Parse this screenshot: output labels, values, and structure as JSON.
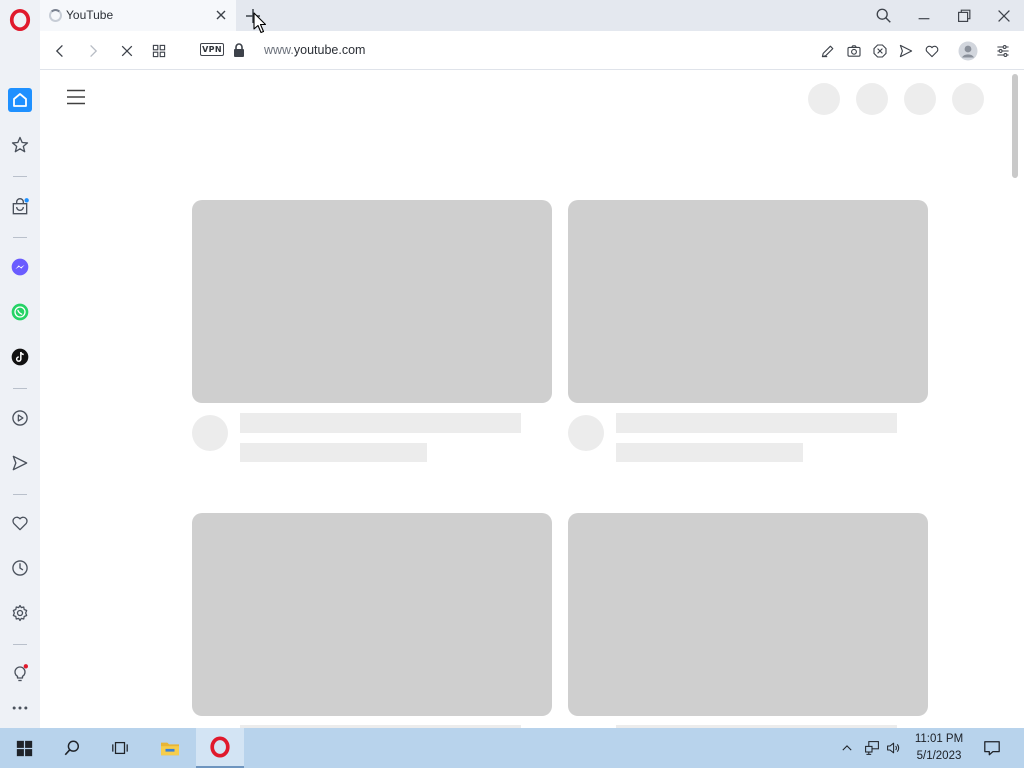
{
  "colors": {
    "sidebar_bg": "#eef1f6",
    "accent_blue": "#1e90ff",
    "messenger": "#6a5cff",
    "whatsapp": "#25d366",
    "tiktok": "#111111",
    "opera_red": "#e0192c",
    "skeleton_dark": "#cfcfcf",
    "skeleton_light": "#ececec",
    "taskbar_bg": "#b8d3ec"
  },
  "browser": {
    "tab": {
      "title": "YouTube",
      "loading": true
    },
    "address": {
      "vpn_label": "VPN",
      "url_dim": "www.",
      "url_main": "youtube.com"
    },
    "sidebar_icons": [
      "opera-logo-icon",
      "home-icon",
      "star-icon",
      "shopping-bag-icon",
      "messenger-icon",
      "whatsapp-icon",
      "tiktok-icon",
      "player-icon",
      "send-icon",
      "heart-icon",
      "history-icon",
      "settings-icon",
      "lightbulb-icon",
      "more-icon"
    ],
    "toolbar_icons": [
      "edit-icon",
      "camera-icon",
      "adblock-icon",
      "send-icon",
      "heart-icon",
      "profile-icon",
      "easy-setup-icon"
    ]
  },
  "taskbar": {
    "clock": {
      "time": "11:01 PM",
      "date": "5/1/2023"
    },
    "apps": [
      "start-icon",
      "search-icon",
      "task-view-icon",
      "file-explorer-icon",
      "opera-icon"
    ]
  }
}
